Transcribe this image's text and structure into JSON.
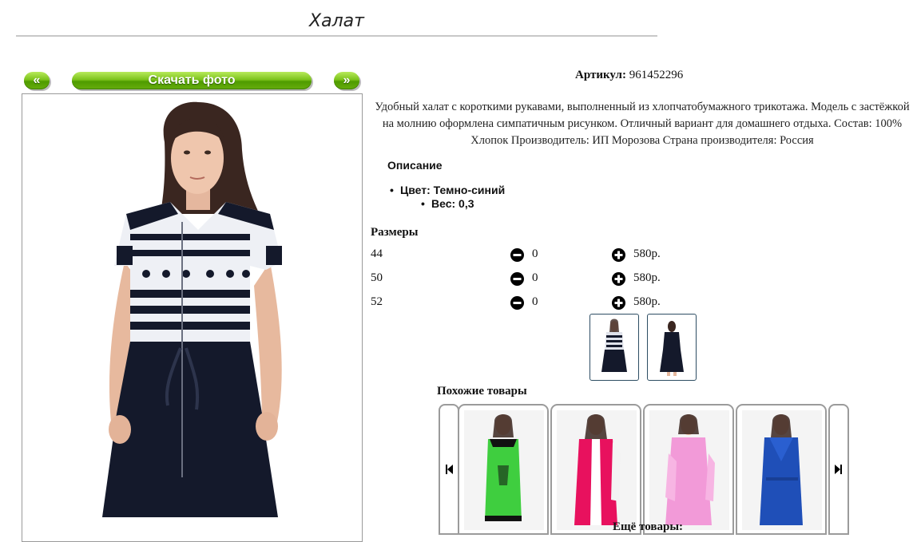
{
  "page": {
    "title": "Халат"
  },
  "gallery": {
    "prev_label": "«",
    "download_label": "Скачать фото",
    "next_label": "»"
  },
  "product": {
    "article_label": "Артикул:",
    "article_value": "961452296",
    "description": "Удобный халат с короткими рукавами, выполненный из хлопчатобумажного трикотажа. Модель с застёжкой на молнию оформлена симпатичным рисунком. Отличный вариант для домашнего отдыха. Состав: 100% Хлопок Производитель: ИП Морозова Страна производителя: Россия",
    "specs_heading": "Описание",
    "spec_color": "Цвет: Темно-синий",
    "spec_weight": "Вес: 0,3",
    "sizes_heading": "Размеры",
    "sizes": [
      {
        "size": "44",
        "qty": "0",
        "price": "580р."
      },
      {
        "size": "50",
        "qty": "0",
        "price": "580р."
      },
      {
        "size": "52",
        "qty": "0",
        "price": "580р."
      }
    ]
  },
  "similar": {
    "heading": "Похожие товары",
    "items": [
      {
        "icon": "dress-green-thumbnail"
      },
      {
        "icon": "robe-pink-white-thumbnail"
      },
      {
        "icon": "robe-light-pink-thumbnail"
      },
      {
        "icon": "robe-blue-thumbnail"
      }
    ]
  },
  "more_heading": "Ещё товары:",
  "colors": {
    "button_green": "#6ab514",
    "thumb_border": "#2d4d63",
    "garment_navy": "#14192b"
  }
}
